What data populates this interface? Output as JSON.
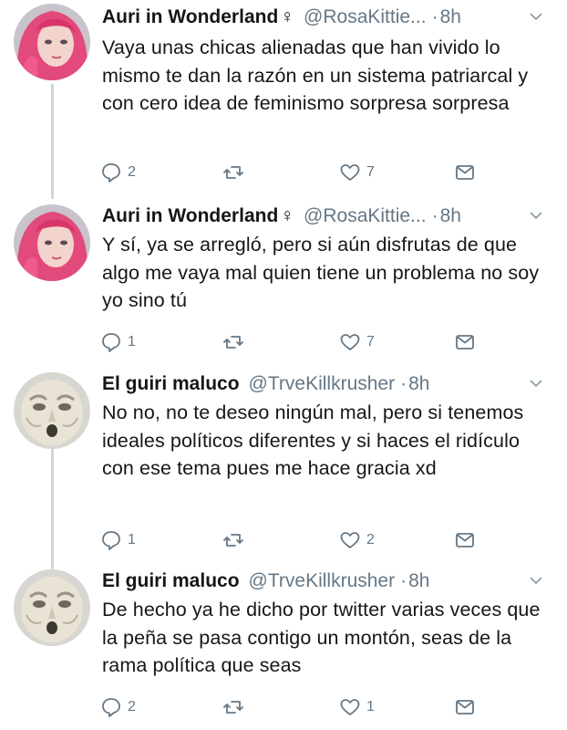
{
  "tweets": [
    {
      "name": "Auri in Wonderland",
      "badge": "♀",
      "handle": "@RosaKittie...",
      "dot": "·",
      "time": "8h",
      "avatar": "pink-hair-avatar",
      "text": "Vaya unas chicas alienadas que han vivido lo mismo te dan la razón en un sistema patriarcal y con cero idea de feminismo sorpresa sorpresa",
      "replies": "2",
      "retweets": "",
      "likes": "7"
    },
    {
      "name": "Auri in Wonderland",
      "badge": "♀",
      "handle": "@RosaKittie...",
      "dot": "·",
      "time": "8h",
      "avatar": "pink-hair-avatar",
      "text": "Y sí, ya se arregló, pero si aún disfrutas de que algo me vaya mal quien tiene un problema no soy yo sino tú",
      "replies": "1",
      "retweets": "",
      "likes": "7"
    },
    {
      "name": "El guiri maluco",
      "badge": "",
      "handle": "@TrveKillkrusher",
      "dot": "·",
      "time": "8h",
      "avatar": "face-mask-avatar",
      "text": "No no, no te deseo ningún mal, pero si tenemos ideales políticos diferentes y si haces el ridículo con ese tema pues me hace gracia xd",
      "replies": "1",
      "retweets": "",
      "likes": "2"
    },
    {
      "name": "El guiri maluco",
      "badge": "",
      "handle": "@TrveKillkrusher",
      "dot": "·",
      "time": "8h",
      "avatar": "face-mask-avatar",
      "text": "De hecho ya he dicho por twitter varias veces que la peña se pasa contigo un montón, seas de la rama política que seas",
      "replies": "2",
      "retweets": "",
      "likes": "1"
    }
  ],
  "colors": {
    "text": "#14171a",
    "secondary": "#657786",
    "thread_line": "#ccd6dd"
  },
  "icons": [
    "reply-icon",
    "retweet-icon",
    "like-icon",
    "dm-icon",
    "chevron-down-icon"
  ]
}
